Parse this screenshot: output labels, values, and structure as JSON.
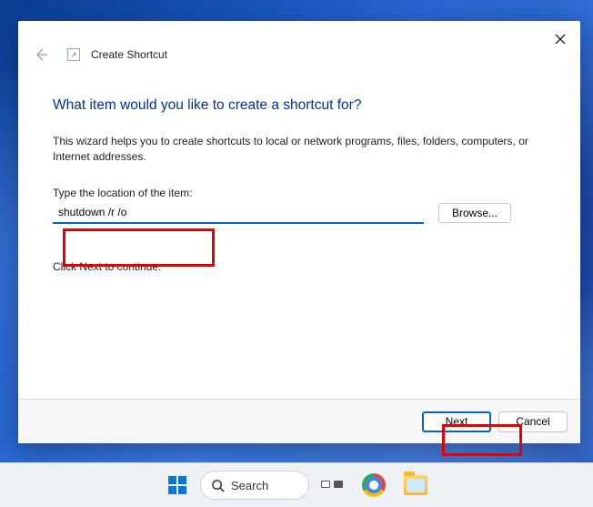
{
  "dialog": {
    "title": "Create Shortcut",
    "headline": "What item would you like to create a shortcut for?",
    "help_text": "This wizard helps you to create shortcuts to local or network programs, files, folders, computers, or Internet addresses.",
    "field_label": "Type the location of the item:",
    "location_value": "shutdown /r /o",
    "browse_label": "Browse...",
    "continue_text": "Click Next to continue.",
    "next_label": "Next",
    "cancel_label": "Cancel",
    "shortcut_glyph": "↗"
  },
  "taskbar": {
    "search_label": "Search"
  }
}
